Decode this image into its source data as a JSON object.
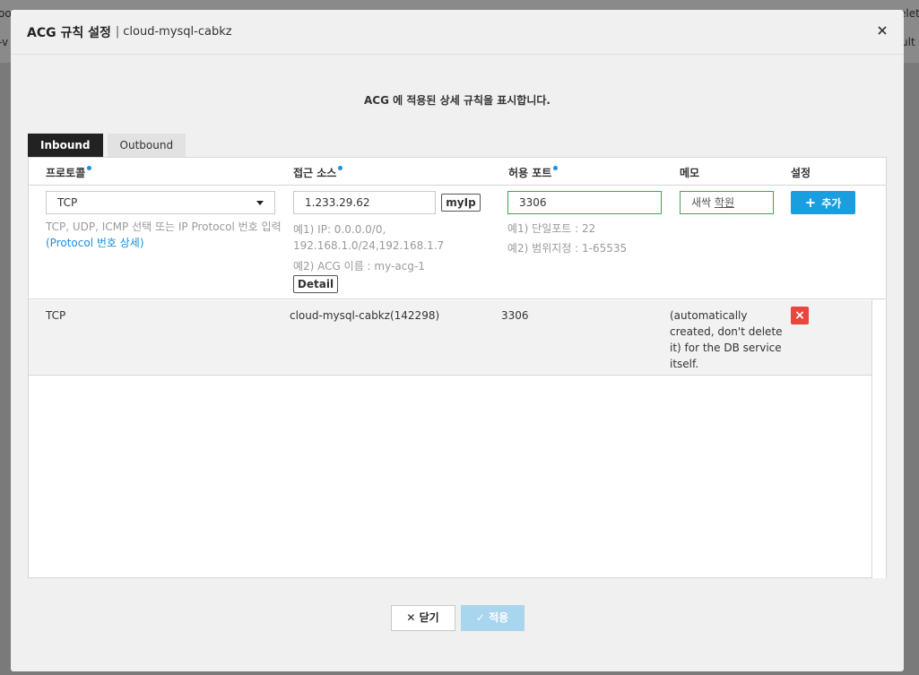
{
  "modal": {
    "title": "ACG 규칙 설정",
    "separator": "|",
    "subtitle": "cloud-mysql-cabkz",
    "description": "ACG 에 적용된 상세 규칙을 표시합니다."
  },
  "tabs": [
    {
      "label": "Inbound",
      "active": true
    },
    {
      "label": "Outbound",
      "active": false
    }
  ],
  "columns": {
    "protocol": "프로토콜",
    "source": "접근 소스",
    "port": "허용 포트",
    "memo": "메모",
    "settings": "설정"
  },
  "input_row": {
    "protocol_value": "TCP",
    "protocol_hint": "TCP, UDP, ICMP 선택 또는 IP Protocol 번호 입력",
    "protocol_link": "(Protocol 번호 상세)",
    "source_value": "1.233.29.62",
    "myip_label": "myIp",
    "source_hint1": "예1) IP: 0.0.0.0/0,",
    "source_hint2": "192.168.1.0/24,192.168.1.7",
    "source_hint3": "예2) ACG 이름 : my-acg-1",
    "detail_label": "Detail",
    "port_value": "3306",
    "port_hint1": "예1) 단일포트 : 22",
    "port_hint2": "예2) 범위지정 : 1-65535",
    "memo_placeholder_a": "새싹 ",
    "memo_placeholder_b": "학원",
    "add_label": "추가"
  },
  "rules": [
    {
      "protocol": "TCP",
      "source": "cloud-mysql-cabkz(142298)",
      "port": "3306",
      "memo_lines": [
        "(automatically",
        "created, don't delete",
        "it) for the DB service",
        "itself."
      ]
    }
  ],
  "footer": {
    "close_label": "닫기",
    "apply_label": "적용"
  },
  "background": {
    "left_top": "oo",
    "left_mid": "-v",
    "right_top": "elet",
    "right_mid": "ult"
  },
  "colors": {
    "accent": "#1a9ee0",
    "delete": "#e8473c",
    "valid_border": "#3aa655",
    "apply_disabled": "#a8d6ee"
  }
}
